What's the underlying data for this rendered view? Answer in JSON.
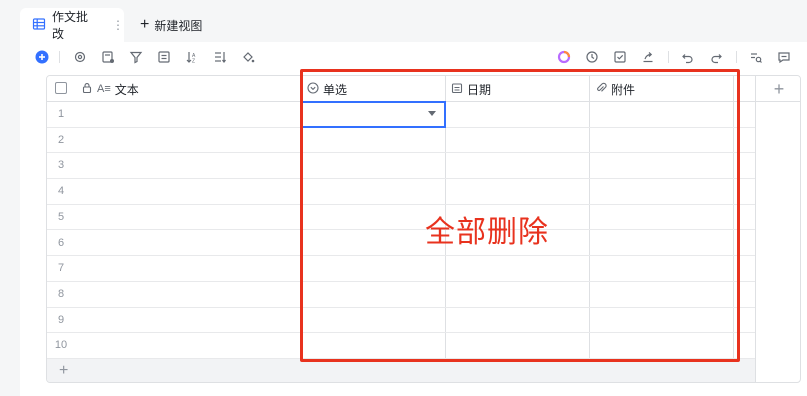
{
  "tabs": {
    "active_label": "作文批改",
    "more_label": "⋮",
    "new_view_label": "新建视图"
  },
  "toolbar": {
    "icons": [
      "add-record-icon",
      "settings-icon",
      "field-config-icon",
      "filter-icon",
      "group-icon",
      "sort-icon",
      "row-height-icon",
      "fill-color-icon",
      "ai-icon",
      "history-icon",
      "checklist-icon",
      "share-icon",
      "undo-icon",
      "redo-icon",
      "search-icon",
      "comment-icon"
    ]
  },
  "grid": {
    "columns": [
      {
        "label": "文本",
        "icon": "text-field-icon",
        "locked": true
      },
      {
        "label": "单选",
        "icon": "single-select-icon"
      },
      {
        "label": "日期",
        "icon": "date-icon"
      },
      {
        "label": "附件",
        "icon": "attachment-icon"
      }
    ],
    "add_column_label": "+",
    "row_numbers": [
      "1",
      "2",
      "3",
      "4",
      "5",
      "6",
      "7",
      "8",
      "9",
      "10"
    ],
    "add_row_label": "+"
  },
  "annotation": {
    "text": "全部删除",
    "color": "#e8321e"
  },
  "colors": {
    "accent": "#3370ff",
    "border": "#dee0e3",
    "annotation_red": "#e8321e"
  }
}
